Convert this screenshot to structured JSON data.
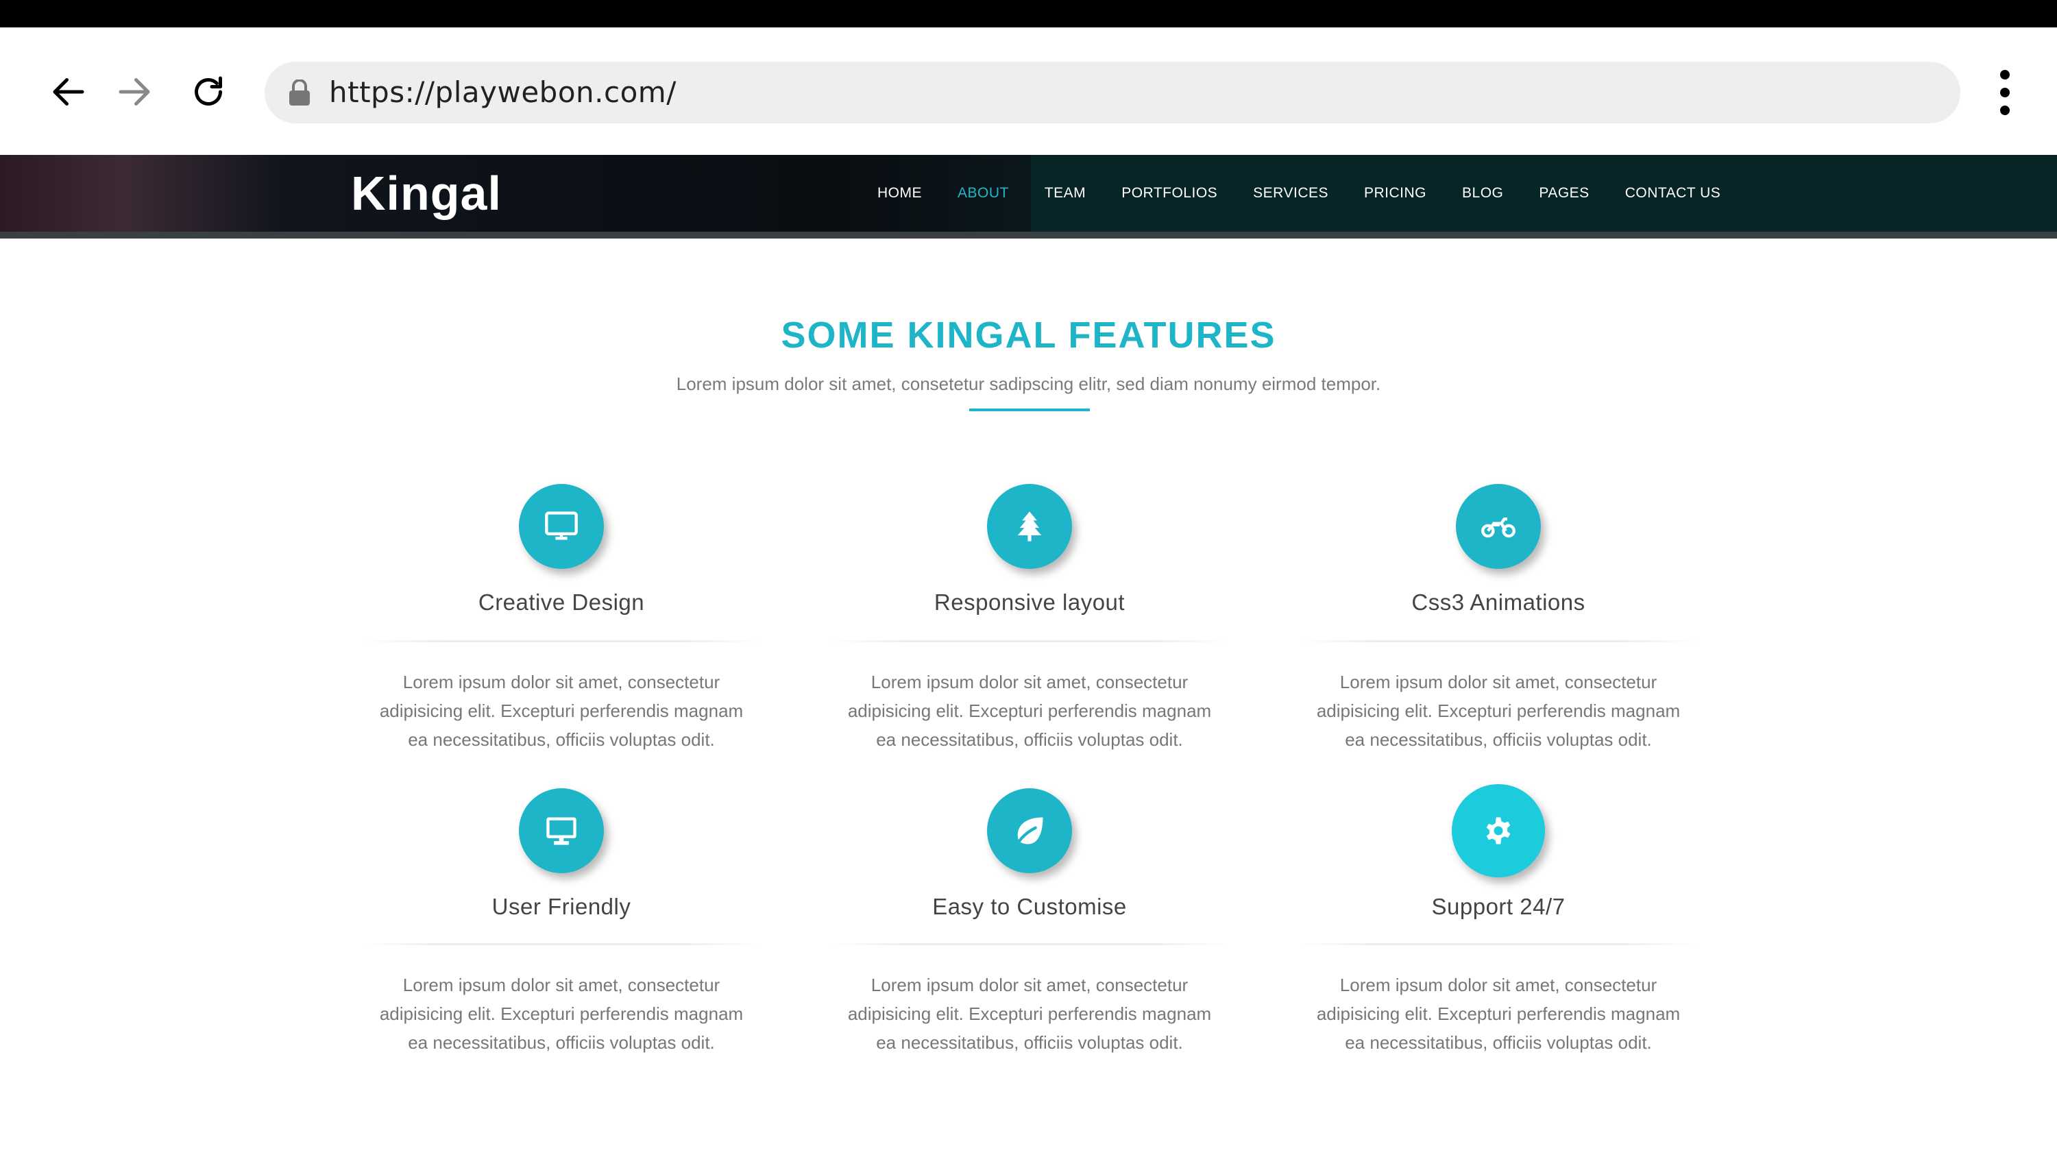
{
  "browser": {
    "url": "https://playwebon.com/"
  },
  "site": {
    "logo": "Kingal",
    "nav": [
      "HOME",
      "ABOUT",
      "TEAM",
      "PORTFOLIOS",
      "SERVICES",
      "PRICING",
      "BLOG",
      "PAGES",
      "CONTACT US"
    ],
    "active_nav": "ABOUT"
  },
  "colors": {
    "accent": "#1fb5c8",
    "header_bg": "#0a2326",
    "text": "#444444"
  },
  "features_section": {
    "title": "SOME KINGAL FEATURES",
    "subtitle": "Lorem ipsum dolor sit amet, consetetur sadipscing elitr, sed diam nonumy eirmod tempor.",
    "features": [
      {
        "icon": "monitor-icon",
        "title": "Creative Design",
        "desc1": "Lorem ipsum dolor sit amet, consectetur",
        "desc2": "adipisicing elit. Excepturi perferendis magnam",
        "desc3": "ea necessitatibus, officiis voluptas odit."
      },
      {
        "icon": "tree-icon",
        "title": "Responsive layout",
        "desc1": "Lorem ipsum dolor sit amet, consectetur",
        "desc2": "adipisicing elit. Excepturi perferendis magnam",
        "desc3": "ea necessitatibus, officiis voluptas odit."
      },
      {
        "icon": "motorcycle-icon",
        "title": "Css3 Animations",
        "desc1": "Lorem ipsum dolor sit amet, consectetur",
        "desc2": "adipisicing elit. Excepturi perferendis magnam",
        "desc3": "ea necessitatibus, officiis voluptas odit."
      },
      {
        "icon": "desktop-icon",
        "title": "User Friendly",
        "desc1": "Lorem ipsum dolor sit amet, consectetur",
        "desc2": "adipisicing elit. Excepturi perferendis magnam",
        "desc3": "ea necessitatibus, officiis voluptas odit."
      },
      {
        "icon": "leaf-icon",
        "title": "Easy to Customise",
        "desc1": "Lorem ipsum dolor sit amet, consectetur",
        "desc2": "adipisicing elit. Excepturi perferendis magnam",
        "desc3": "ea necessitatibus, officiis voluptas odit."
      },
      {
        "icon": "gear-icon",
        "title": "Support 24/7",
        "desc1": "Lorem ipsum dolor sit amet, consectetur",
        "desc2": "adipisicing elit. Excepturi perferendis magnam",
        "desc3": "ea necessitatibus, officiis voluptas odit."
      }
    ]
  }
}
